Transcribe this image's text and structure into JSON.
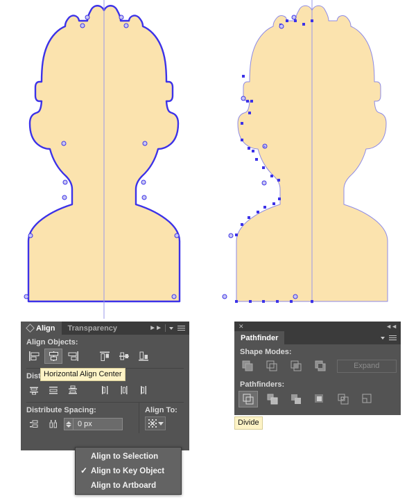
{
  "artwork": {
    "left_figure": {
      "name": "avatar-silhouette-selected",
      "fill": "#fbe3ae",
      "stroke": "#3c32e8",
      "anchor_fill": "#b9b6ee",
      "guide_color": "#8d8ae6"
    },
    "right_figure": {
      "name": "avatar-silhouette-half-selected",
      "fill": "#fbe3ae",
      "stroke": "#8d8ae6",
      "anchor_fill": "#3c32e8"
    }
  },
  "align_panel": {
    "tabs": [
      {
        "label": "Align",
        "active": true
      },
      {
        "label": "Transparency",
        "active": false
      }
    ],
    "sections": {
      "align_objects_label": "Align Objects:",
      "distribute_objects_label": "Distribute Objects:",
      "distribute_spacing_label": "Distribute Spacing:",
      "align_to_label": "Align To:"
    },
    "align_buttons": [
      {
        "name": "horizontal-align-left",
        "selected": false
      },
      {
        "name": "horizontal-align-center",
        "selected": true
      },
      {
        "name": "horizontal-align-right",
        "selected": false
      },
      {
        "name": "vertical-align-top",
        "selected": false
      },
      {
        "name": "vertical-align-center",
        "selected": false
      },
      {
        "name": "vertical-align-bottom",
        "selected": false
      }
    ],
    "distribute_buttons": [
      {
        "name": "vertical-distribute-top",
        "selected": false
      },
      {
        "name": "vertical-distribute-center",
        "selected": false
      },
      {
        "name": "vertical-distribute-bottom",
        "selected": false
      },
      {
        "name": "horizontal-distribute-left",
        "selected": false
      },
      {
        "name": "horizontal-distribute-center",
        "selected": false
      },
      {
        "name": "horizontal-distribute-right",
        "selected": false
      }
    ],
    "spacing_buttons": [
      {
        "name": "vertical-distribute-space",
        "selected": false
      },
      {
        "name": "horizontal-distribute-space",
        "selected": false
      }
    ],
    "spacing_value": "0 px",
    "spacing_placeholder": "0 px"
  },
  "pathfinder_panel": {
    "tab_label": "Pathfinder",
    "shape_modes_label": "Shape Modes:",
    "pathfinders_label": "Pathfinders:",
    "expand_label": "Expand",
    "shape_mode_buttons": [
      {
        "name": "unite",
        "selected": false
      },
      {
        "name": "minus-front",
        "selected": false
      },
      {
        "name": "intersect",
        "selected": false
      },
      {
        "name": "exclude",
        "selected": false
      }
    ],
    "pathfinder_buttons": [
      {
        "name": "divide",
        "selected": true
      },
      {
        "name": "trim",
        "selected": false
      },
      {
        "name": "merge",
        "selected": false
      },
      {
        "name": "crop",
        "selected": false
      },
      {
        "name": "outline",
        "selected": false
      },
      {
        "name": "minus-back",
        "selected": false
      }
    ]
  },
  "tooltips": {
    "align": "Horizontal Align Center",
    "divide": "Divide"
  },
  "align_to_menu": {
    "items": [
      {
        "label": "Align to Selection",
        "checked": false
      },
      {
        "label": "Align to Key Object",
        "checked": true
      },
      {
        "label": "Align to Artboard",
        "checked": false
      }
    ],
    "check_glyph": "✓"
  },
  "colors": {
    "panel_bg": "#535353",
    "panel_header": "#3b3b3b",
    "tooltip_bg": "#fdf3c6",
    "selection_blue": "#3c32e8",
    "shape_fill": "#fbe3ae"
  }
}
